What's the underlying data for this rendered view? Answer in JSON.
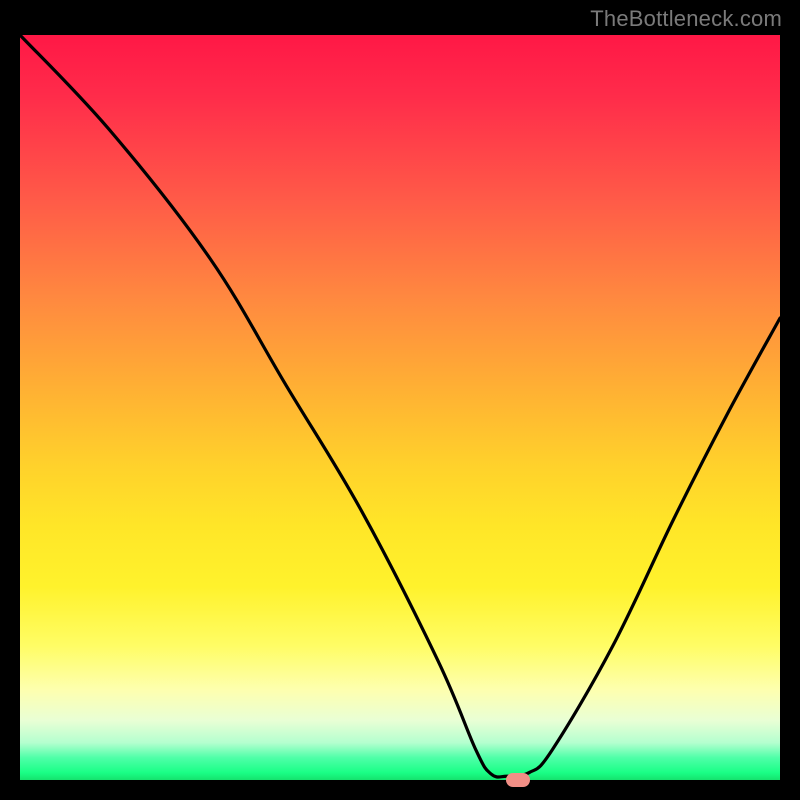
{
  "watermark": "TheBottleneck.com",
  "chart_data": {
    "type": "line",
    "title": "",
    "xlabel": "",
    "ylabel": "",
    "xlim": [
      0,
      100
    ],
    "ylim": [
      0,
      100
    ],
    "grid": false,
    "series": [
      {
        "name": "curve",
        "x": [
          0,
          12,
          25,
          35,
          45,
          55,
          60,
          62,
          64,
          67,
          70,
          78,
          86,
          93,
          100
        ],
        "values": [
          100,
          87,
          70,
          53,
          36,
          16,
          4,
          0.8,
          0.5,
          1.0,
          4,
          18,
          35,
          49,
          62
        ]
      }
    ],
    "marker": {
      "x": 65.5,
      "y": 0
    },
    "background_gradient": {
      "type": "vertical",
      "stops": [
        {
          "pos": 0.0,
          "color": "#ff1846"
        },
        {
          "pos": 0.5,
          "color": "#ffb233"
        },
        {
          "pos": 0.8,
          "color": "#fff22c"
        },
        {
          "pos": 0.95,
          "color": "#b4ffcf"
        },
        {
          "pos": 1.0,
          "color": "#15e26d"
        }
      ]
    }
  }
}
